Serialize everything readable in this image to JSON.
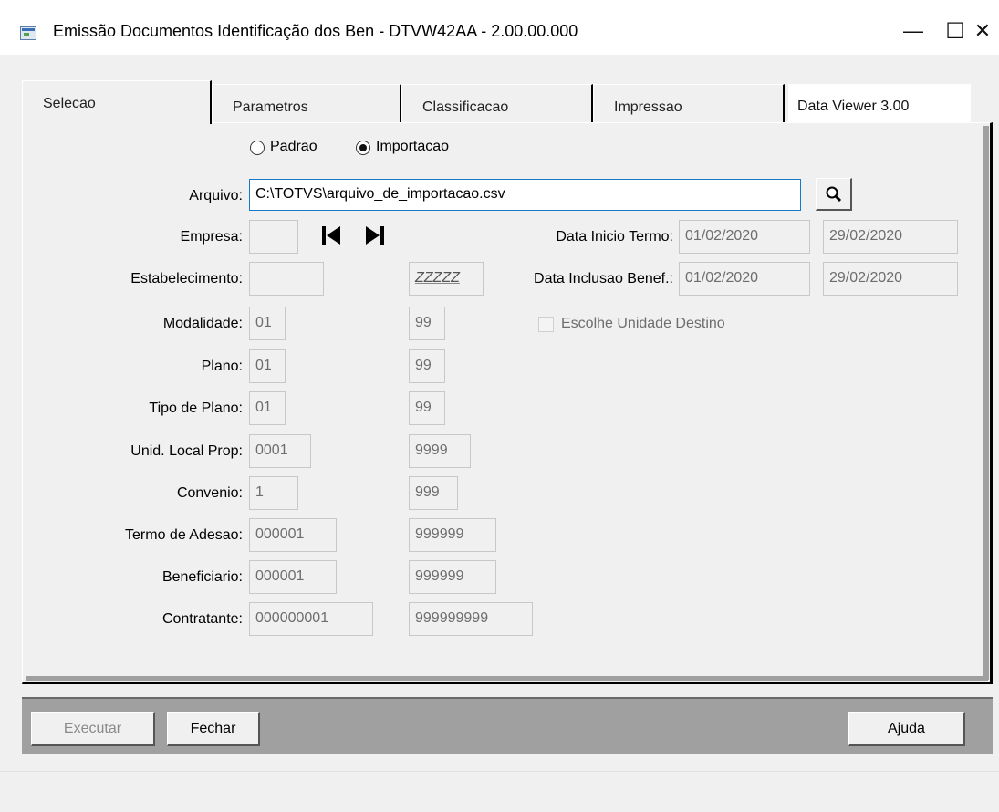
{
  "window": {
    "title": "Emissão Documentos Identificação dos Ben - DTVW42AA - 2.00.00.000",
    "minimize": "—",
    "maximize": "☐",
    "close": "✕"
  },
  "tabs": [
    {
      "label": "Selecao"
    },
    {
      "label": "Parametros"
    },
    {
      "label": "Classificacao"
    },
    {
      "label": "Impressao"
    },
    {
      "label": "Data Viewer 3.00"
    }
  ],
  "mode": {
    "options": [
      {
        "label": "Padrao",
        "selected": false
      },
      {
        "label": "Importacao",
        "selected": true
      }
    ]
  },
  "arquivo": {
    "label": "Arquivo:",
    "value": "C:\\TOTVS\\arquivo_de_importacao.csv"
  },
  "search_icon": "magnifier-icon",
  "empresa": {
    "label": "Empresa:",
    "value": ""
  },
  "nav": {
    "first_icon": "first-record-icon",
    "last_icon": "last-record-icon"
  },
  "estabelecimento": {
    "label": "Estabelecimento:",
    "from": "",
    "to": "ZZZZZ"
  },
  "data_inicio_termo": {
    "label": "Data Inicio Termo:",
    "from": "01/02/2020",
    "to": "29/02/2020"
  },
  "data_inclusao_benef": {
    "label": "Data Inclusao Benef.:",
    "from": "01/02/2020",
    "to": "29/02/2020"
  },
  "escolhe_unidade": {
    "label": "Escolhe Unidade Destino",
    "checked": false
  },
  "ranges": [
    {
      "label": "Modalidade:",
      "from": "01",
      "to": "99"
    },
    {
      "label": "Plano:",
      "from": "01",
      "to": "99"
    },
    {
      "label": "Tipo de Plano:",
      "from": "01",
      "to": "99"
    },
    {
      "label": "Unid. Local Prop:",
      "from": "0001",
      "to": "9999"
    },
    {
      "label": "Convenio:",
      "from": "1",
      "to": "999"
    },
    {
      "label": "Termo de Adesao:",
      "from": "000001",
      "to": "999999"
    },
    {
      "label": "Beneficiario:",
      "from": "000001",
      "to": "999999"
    },
    {
      "label": "Contratante:",
      "from": "000000001",
      "to": "999999999"
    }
  ],
  "buttons": {
    "executar": "Executar",
    "fechar": "Fechar",
    "ajuda": "Ajuda"
  }
}
